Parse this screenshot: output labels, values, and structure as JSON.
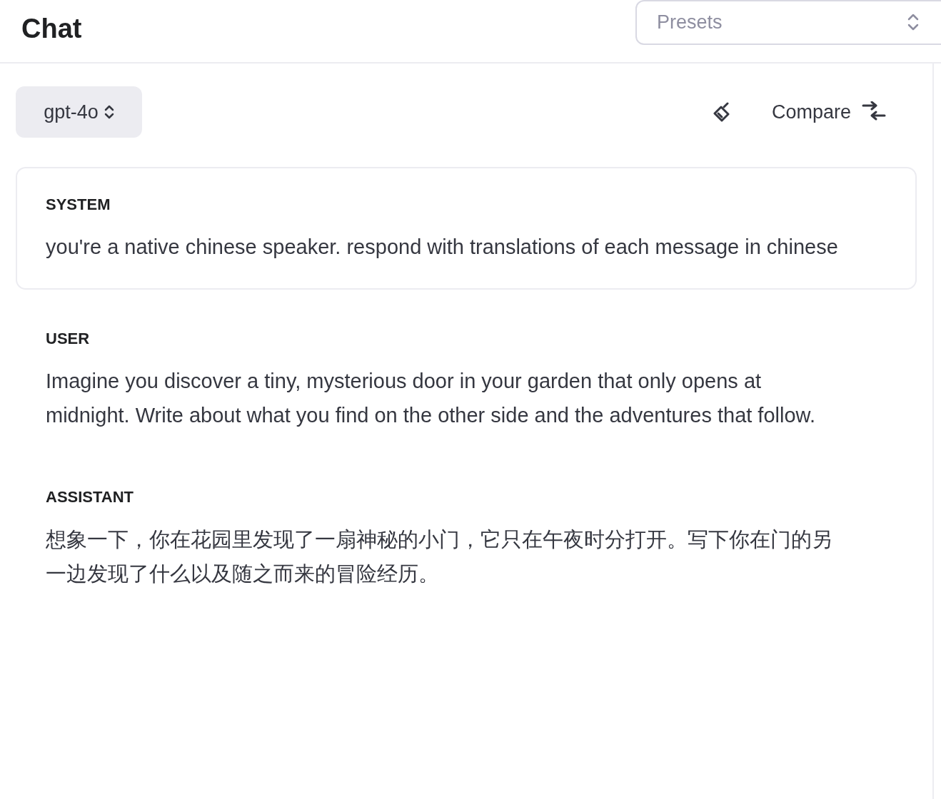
{
  "header": {
    "title": "Chat",
    "presets": {
      "placeholder": "Presets"
    }
  },
  "toolbar": {
    "model": "gpt-4o",
    "compare": "Compare"
  },
  "messages": [
    {
      "kind": "system",
      "role": "SYSTEM",
      "text": "you're a native chinese speaker. respond with translations of each message in chinese"
    },
    {
      "kind": "message",
      "role": "USER",
      "text": "Imagine you discover a tiny, mysterious door in your garden that only opens at midnight. Write about what you find on the other side and the adventures that follow."
    },
    {
      "kind": "message",
      "role": "ASSISTANT",
      "text": "想象一下，你在花园里发现了一扇神秘的小门，它只在午夜时分打开。写下你在门的另一边发现了什么以及随之而来的冒险经历。"
    }
  ]
}
